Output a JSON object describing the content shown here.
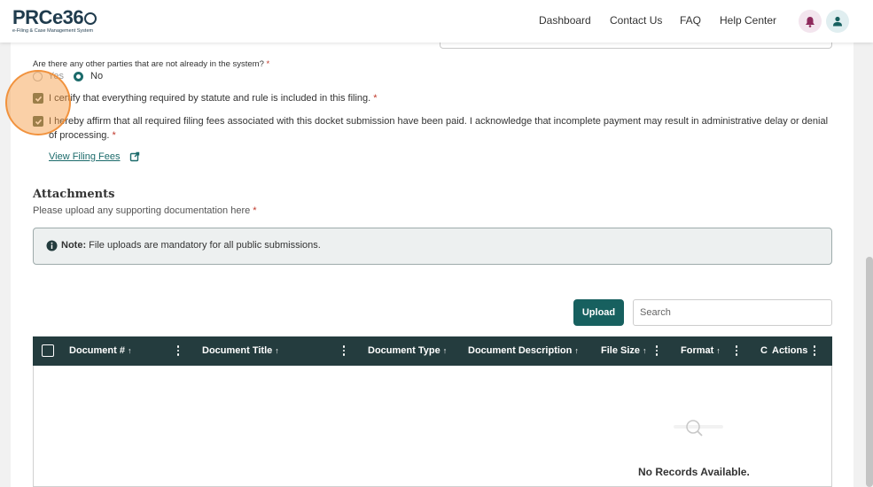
{
  "header": {
    "logo_text": "PRCe36",
    "logo_tagline": "e-Filing & Case Management System",
    "nav": {
      "dashboard": "Dashboard",
      "contact": "Contact Us",
      "faq": "FAQ",
      "help": "Help Center"
    },
    "icons": {
      "notifications": "bell-icon",
      "profile": "user-icon"
    }
  },
  "form": {
    "other_parties_question": "Are there any other parties that are not already in the system?",
    "required_marker": "*",
    "options": {
      "yes": "Yes",
      "no": "No"
    },
    "selected_option": "No",
    "certify_statement": "I certify that everything required by statute and rule is included in this filing.",
    "affirm_statement": "I hereby affirm that all required filing fees associated with this docket submission have been paid. I acknowledge that incomplete payment may result in administrative delay or denial of processing.",
    "certify_checked": true,
    "affirm_checked": true,
    "view_fees_link": "View Filing Fees"
  },
  "attachments": {
    "title": "Attachments",
    "subtitle": "Please upload any supporting documentation here",
    "note_label": "Note:",
    "note_text": "File uploads are mandatory for all public submissions.",
    "upload_label": "Upload",
    "search_placeholder": "Search",
    "columns": {
      "doc_num": "Document #",
      "doc_title": "Document Title",
      "doc_type": "Document Type",
      "doc_desc": "Document Description",
      "file_size": "File Size",
      "format": "Format",
      "truncated": "C",
      "actions": "Actions"
    },
    "sort_arrow": "↑",
    "empty_text": "No Records Available."
  },
  "colors": {
    "primary": "#17605f",
    "table_header": "#243c3e",
    "checkbox": "#556b54",
    "notification_bg": "#f3e5ee"
  }
}
